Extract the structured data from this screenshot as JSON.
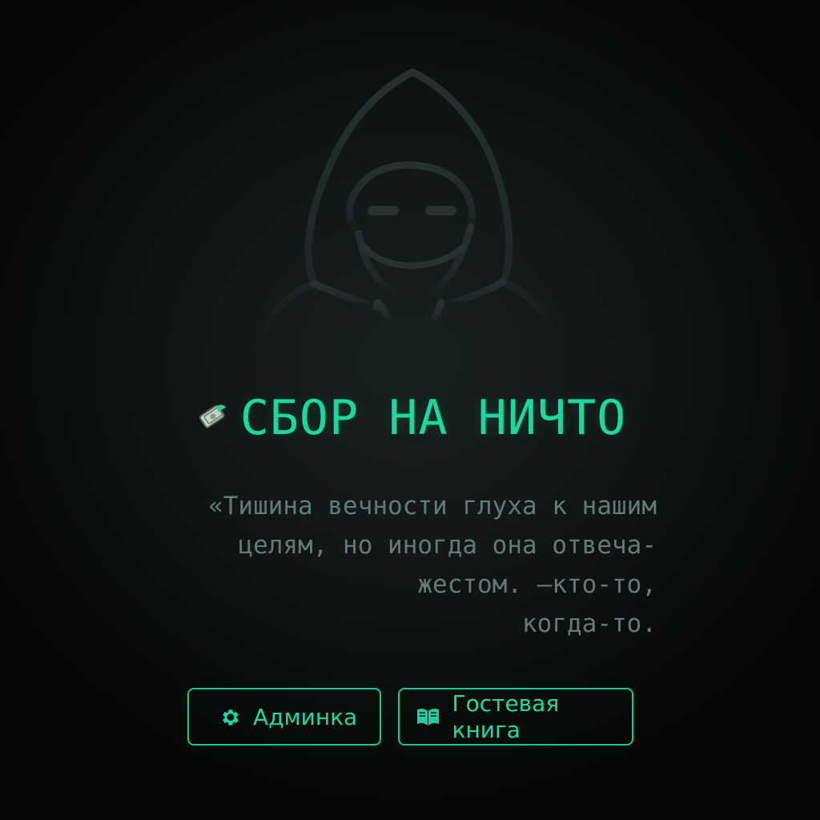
{
  "colors": {
    "accent": "#18d9a0",
    "quote_text": "#667979",
    "silhouette_stroke": "#223030",
    "background": "#0c1111"
  },
  "hero": {
    "icon": "hooded-figure-icon"
  },
  "title": {
    "icon": "money-note-icon",
    "text": "СБОР НА НИЧТО"
  },
  "quote": {
    "lines": [
      "«Тишина вечности глуха к нашим",
      "целям, но иногда она отвеча-",
      "жестом. —кто-то,",
      "когда-то."
    ]
  },
  "actions": [
    {
      "label": "Админка",
      "icon": "gear-icon"
    },
    {
      "label": "Гостевая книга",
      "icon": "book-icon"
    }
  ]
}
